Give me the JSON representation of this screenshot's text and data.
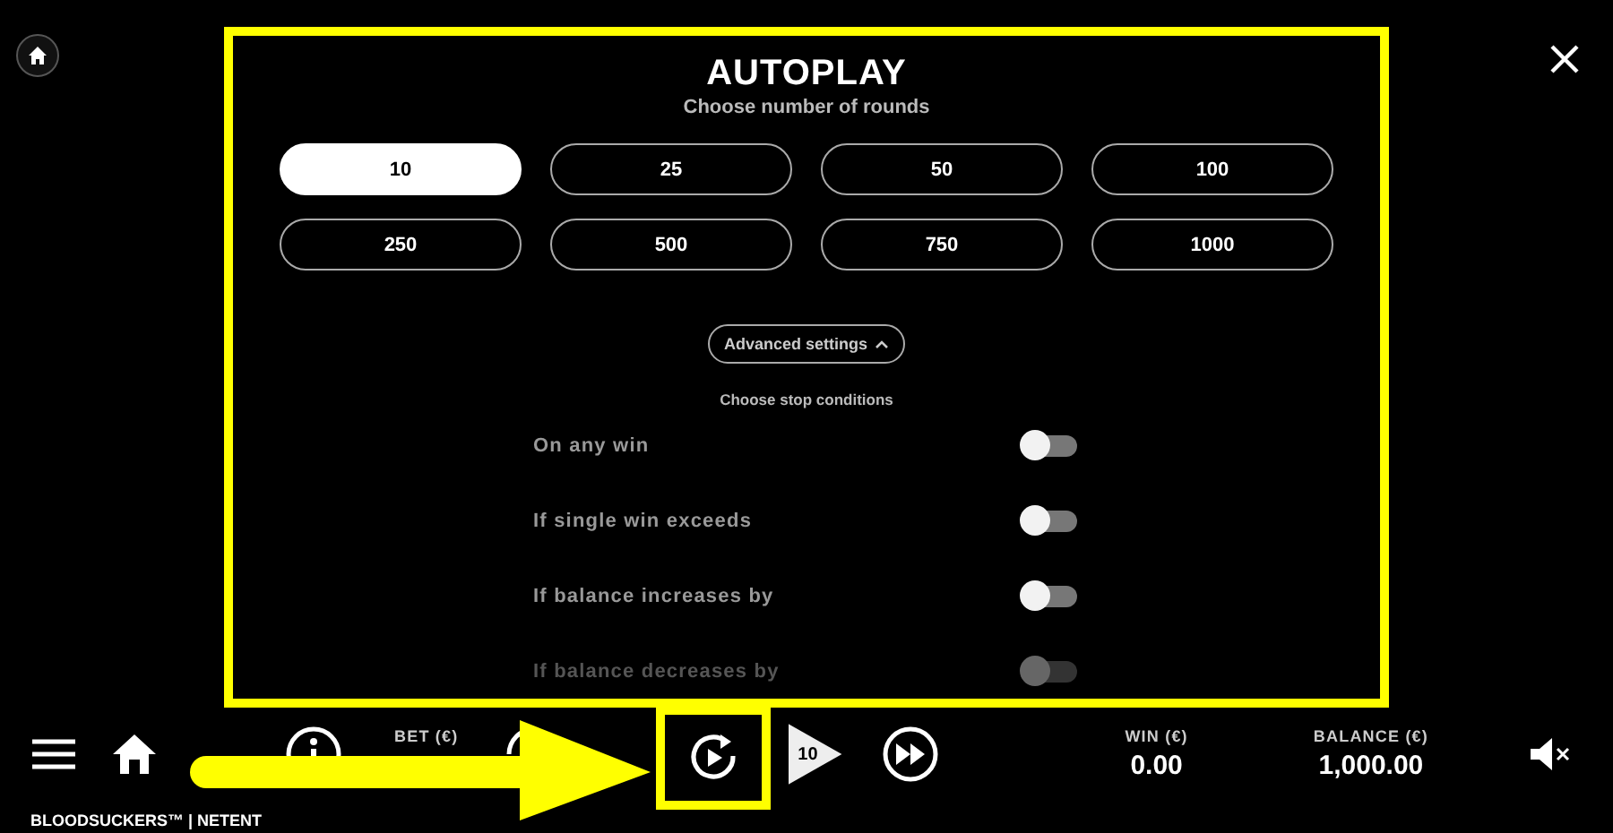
{
  "dialog": {
    "title": "AUTOPLAY",
    "subtitle": "Choose number of rounds",
    "rounds": [
      {
        "label": "10",
        "selected": true
      },
      {
        "label": "25",
        "selected": false
      },
      {
        "label": "50",
        "selected": false
      },
      {
        "label": "100",
        "selected": false
      },
      {
        "label": "250",
        "selected": false
      },
      {
        "label": "500",
        "selected": false
      },
      {
        "label": "750",
        "selected": false
      },
      {
        "label": "1000",
        "selected": false
      }
    ],
    "advanced_button": {
      "label": "Advanced settings",
      "expanded": true
    },
    "stop_conditions_title": "Choose stop conditions",
    "stop_conditions": [
      {
        "label": "On any win",
        "on": false,
        "disabled": false
      },
      {
        "label": "If single win exceeds",
        "on": false,
        "disabled": false
      },
      {
        "label": "If balance increases by",
        "on": false,
        "disabled": false
      },
      {
        "label": "If balance decreases by",
        "on": false,
        "disabled": true
      }
    ]
  },
  "bottom_bar": {
    "bet_label": "BET (€)",
    "spin_count": "10",
    "win_label": "WIN (€)",
    "win_value": "0.00",
    "balance_label": "BALANCE (€)",
    "balance_value": "1,000.00"
  },
  "footer": "BLOODSUCKERS™ | NETENT"
}
